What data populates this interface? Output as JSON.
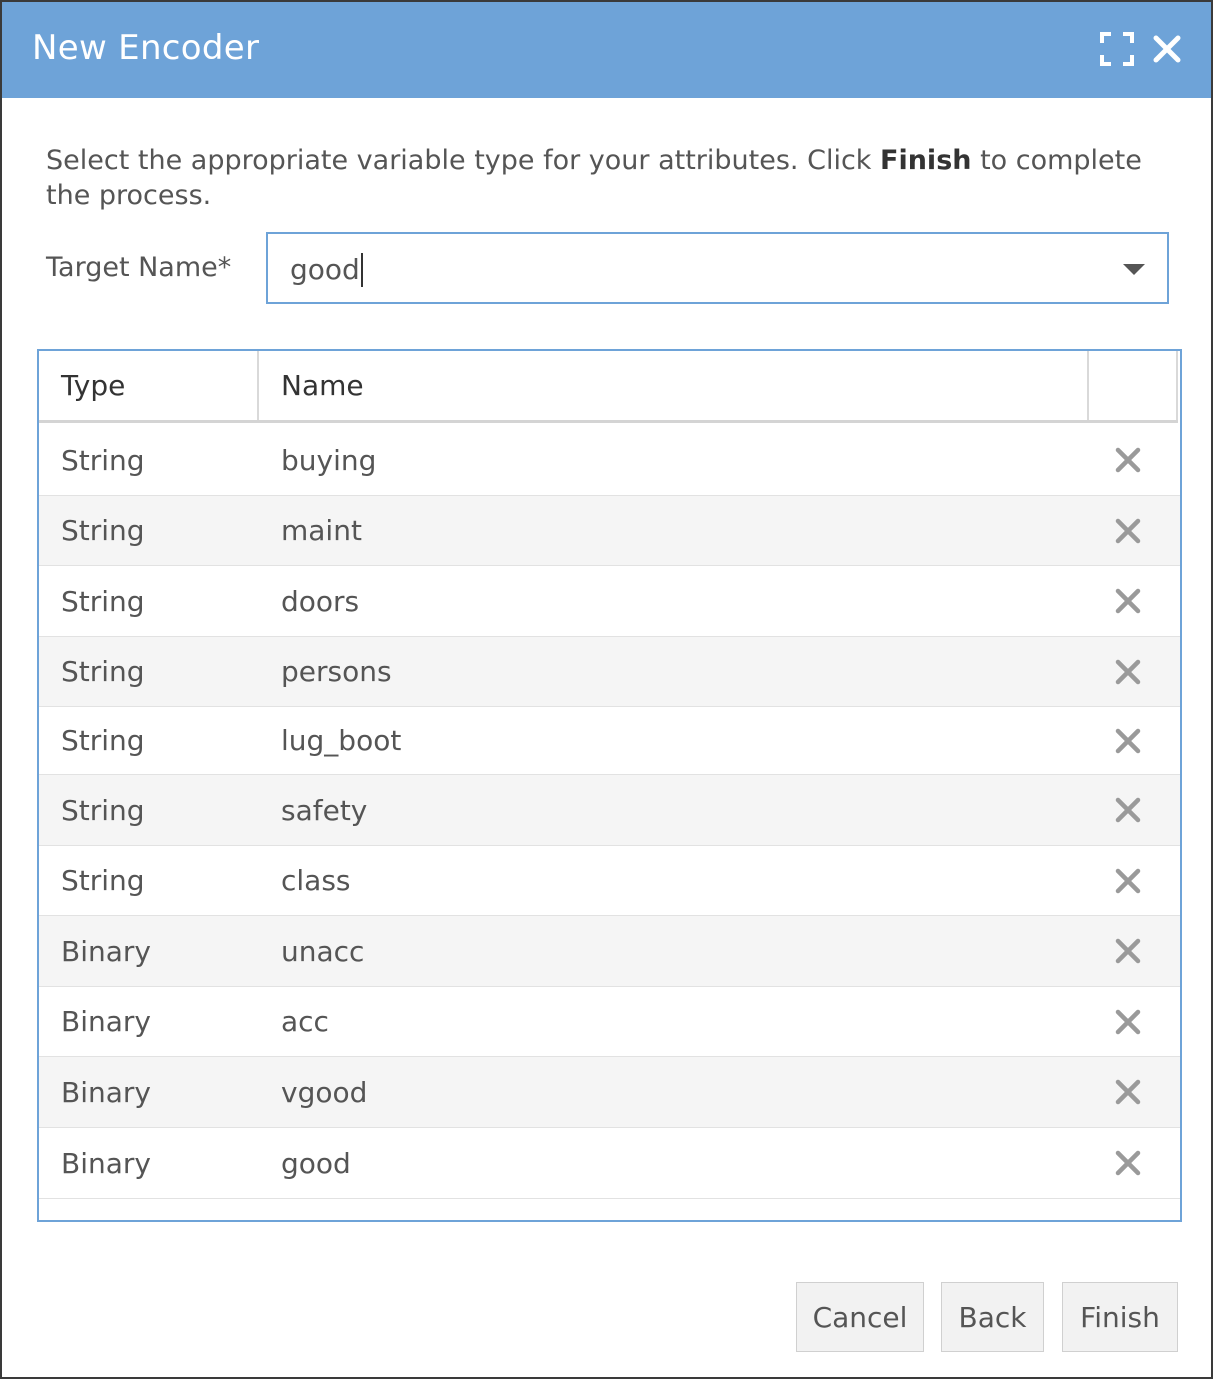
{
  "dialog": {
    "title": "New Encoder",
    "icons": {
      "maximize": "maximize-icon",
      "close": "close-icon"
    },
    "accent_color": "#6ea3d8"
  },
  "instructions": {
    "prefix": "Select the appropriate variable type for your attributes. Click ",
    "bold": "Finish",
    "suffix": " to complete the process."
  },
  "target": {
    "label": "Target Name*",
    "value": "good"
  },
  "table": {
    "columns": [
      "Type",
      "Name",
      ""
    ],
    "rows": [
      {
        "type": "String",
        "name": "buying"
      },
      {
        "type": "String",
        "name": "maint"
      },
      {
        "type": "String",
        "name": "doors"
      },
      {
        "type": "String",
        "name": "persons"
      },
      {
        "type": "String",
        "name": "lug_boot"
      },
      {
        "type": "String",
        "name": "safety"
      },
      {
        "type": "String",
        "name": "class"
      },
      {
        "type": "Binary",
        "name": "unacc"
      },
      {
        "type": "Binary",
        "name": "acc"
      },
      {
        "type": "Binary",
        "name": "vgood"
      },
      {
        "type": "Binary",
        "name": "good"
      }
    ],
    "delete_icon": "delete-icon"
  },
  "buttons": {
    "cancel": "Cancel",
    "back": "Back",
    "finish": "Finish"
  }
}
